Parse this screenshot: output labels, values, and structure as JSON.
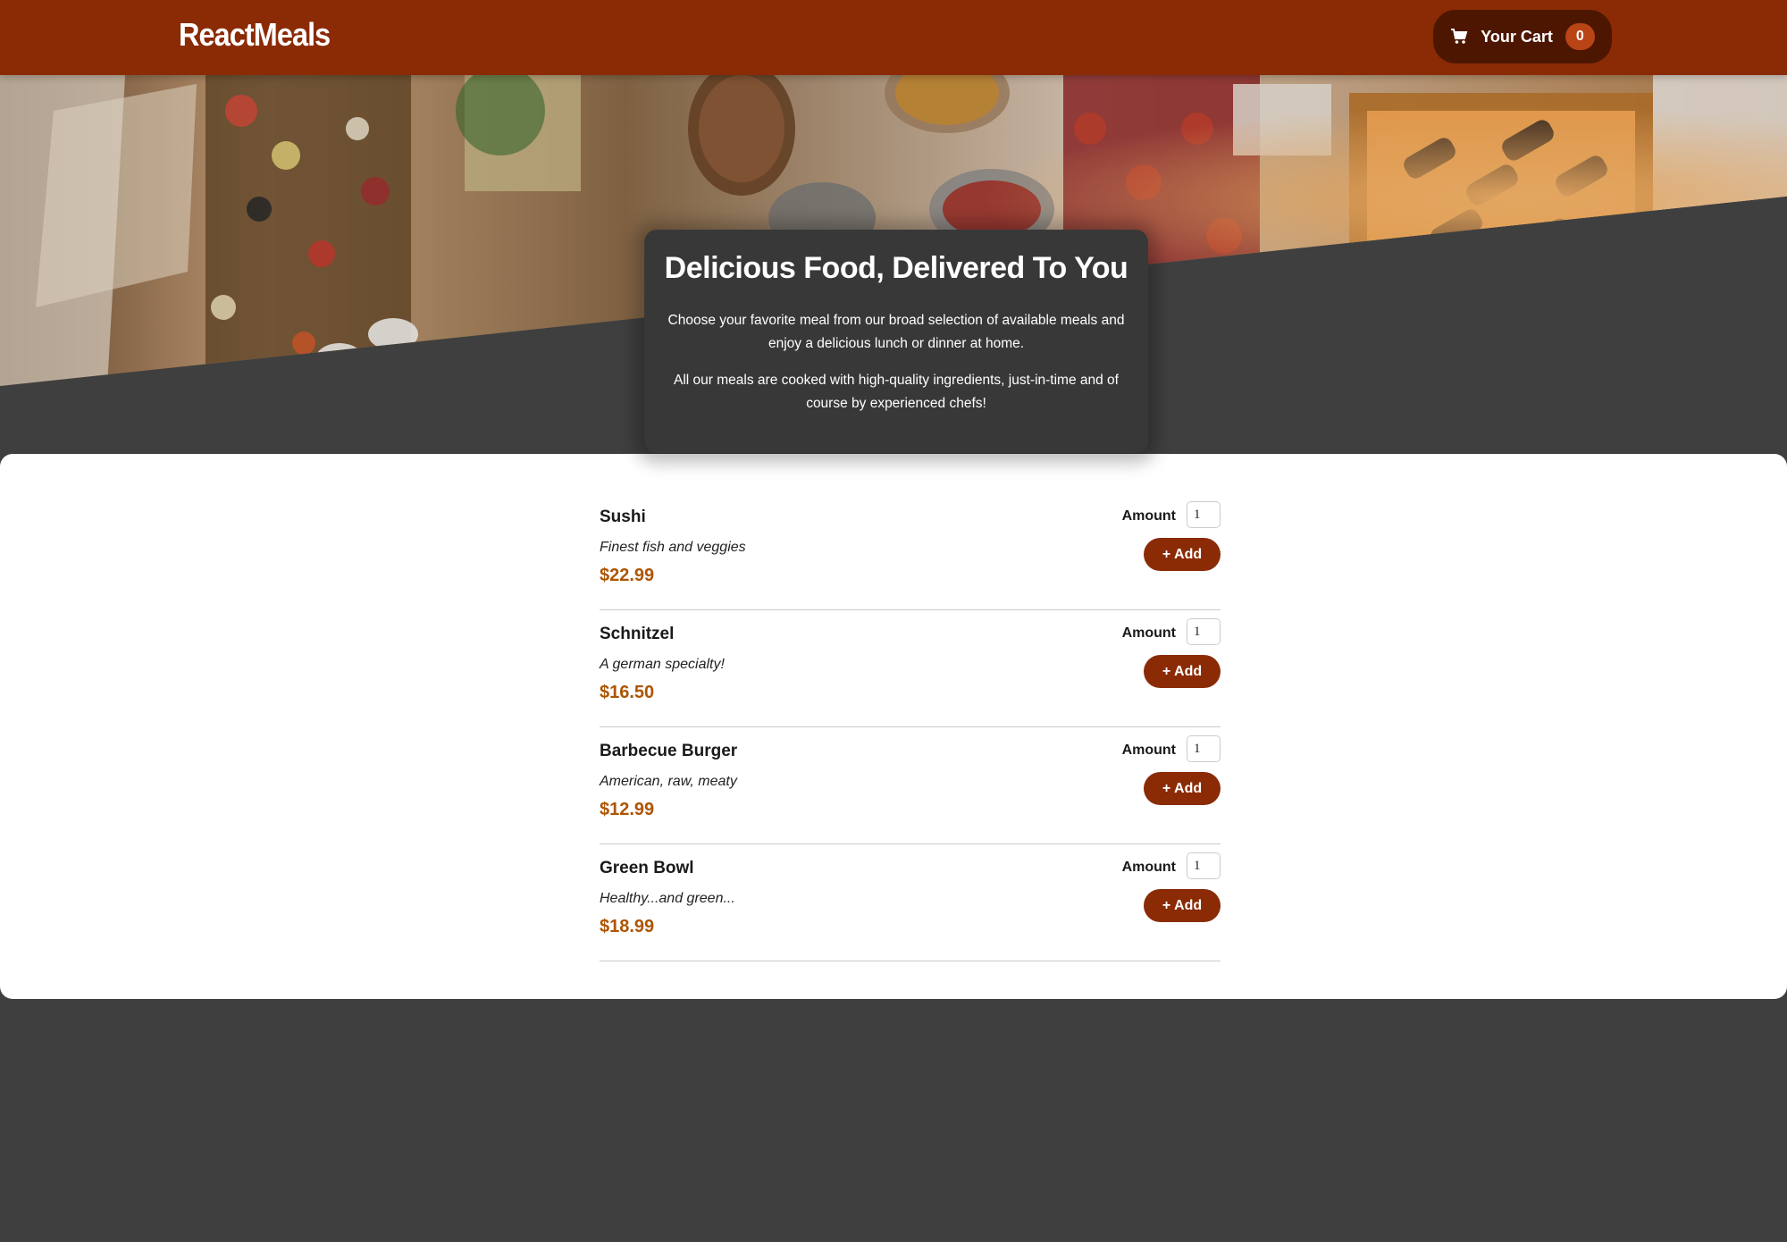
{
  "header": {
    "brand": "ReactMeals",
    "cart": {
      "label": "Your Cart",
      "count": "0",
      "icon": "cart-icon"
    }
  },
  "summary": {
    "title": "Delicious Food, Delivered To You",
    "paragraph1": "Choose your favorite meal from our broad selection of available meals and enjoy a delicious lunch or dinner at home.",
    "paragraph2": "All our meals are cooked with high-quality ingredients, just-in-time and of course by experienced chefs!"
  },
  "meals": [
    {
      "name": "Sushi",
      "description": "Finest fish and veggies",
      "price": "$22.99",
      "amount_label": "Amount",
      "amount": "1",
      "add_label": "+ Add"
    },
    {
      "name": "Schnitzel",
      "description": "A german specialty!",
      "price": "$16.50",
      "amount_label": "Amount",
      "amount": "1",
      "add_label": "+ Add"
    },
    {
      "name": "Barbecue Burger",
      "description": "American, raw, meaty",
      "price": "$12.99",
      "amount_label": "Amount",
      "amount": "1",
      "add_label": "+ Add"
    },
    {
      "name": "Green Bowl",
      "description": "Healthy...and green...",
      "price": "$18.99",
      "amount_label": "Amount",
      "amount": "1",
      "add_label": "+ Add"
    }
  ],
  "colors": {
    "header": "#8a2b06",
    "cart_button": "#4d1601",
    "badge": "#b94517",
    "price": "#ad5502",
    "background": "#3f3f3f",
    "summary_card": "#383838"
  }
}
